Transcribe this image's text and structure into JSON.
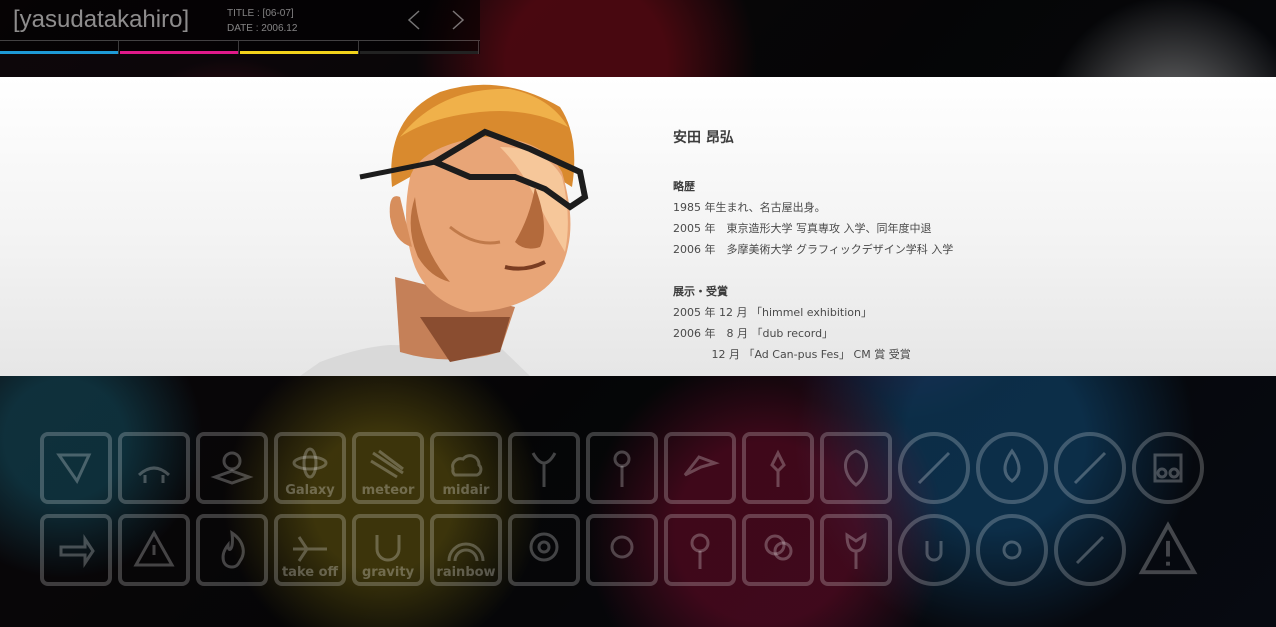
{
  "header": {
    "site_title": "[yasudatakahiro]",
    "title_line": "TITLE : [06-07]",
    "date_line": "DATE : 2006.12",
    "prev_icon": "chevron-left-icon",
    "next_icon": "chevron-right-icon",
    "segment_colors": [
      "#1e9ad6",
      "#e0198a",
      "#f2d21b",
      "#222222"
    ]
  },
  "profile": {
    "name": "安田 昂弘",
    "history_heading": "略歴",
    "history": [
      "1985 年生まれ、名古屋出身。",
      "2005 年　東京造形大学 写真専攻 入学、同年度中退",
      "2006 年　多摩美術大学 グラフィックデザイン学科 入学"
    ],
    "exhibit_heading": "展示・受賞",
    "exhibits": [
      "2005 年 12 月 「himmel exhibition」",
      "2006 年　8 月 「dub record」",
      "           12 月 「Ad Can-pus Fes」 CM 賞 受賞"
    ]
  },
  "thumbnails": {
    "row1": [
      "arrow-sign-icon",
      "hands-icon",
      "sun-box-icon",
      "Galaxy",
      "meteor",
      "midair",
      "flower-icon",
      "flower-icon",
      "bird-icon",
      "lily-icon",
      "leaf-icon",
      "no-sign-icon",
      "drop-icon",
      "no-sign-icon",
      "speaker-icon"
    ],
    "row2": [
      "arrow-sign-icon",
      "warning-icon",
      "fire-icon",
      "take off",
      "gravity",
      "rainbow",
      "daisy-icon",
      "flower-icon",
      "rose-icon",
      "flower-icon",
      "tulip-icon",
      "circle-icon",
      "circle-icon",
      "circle-icon",
      "warning-icon"
    ]
  }
}
